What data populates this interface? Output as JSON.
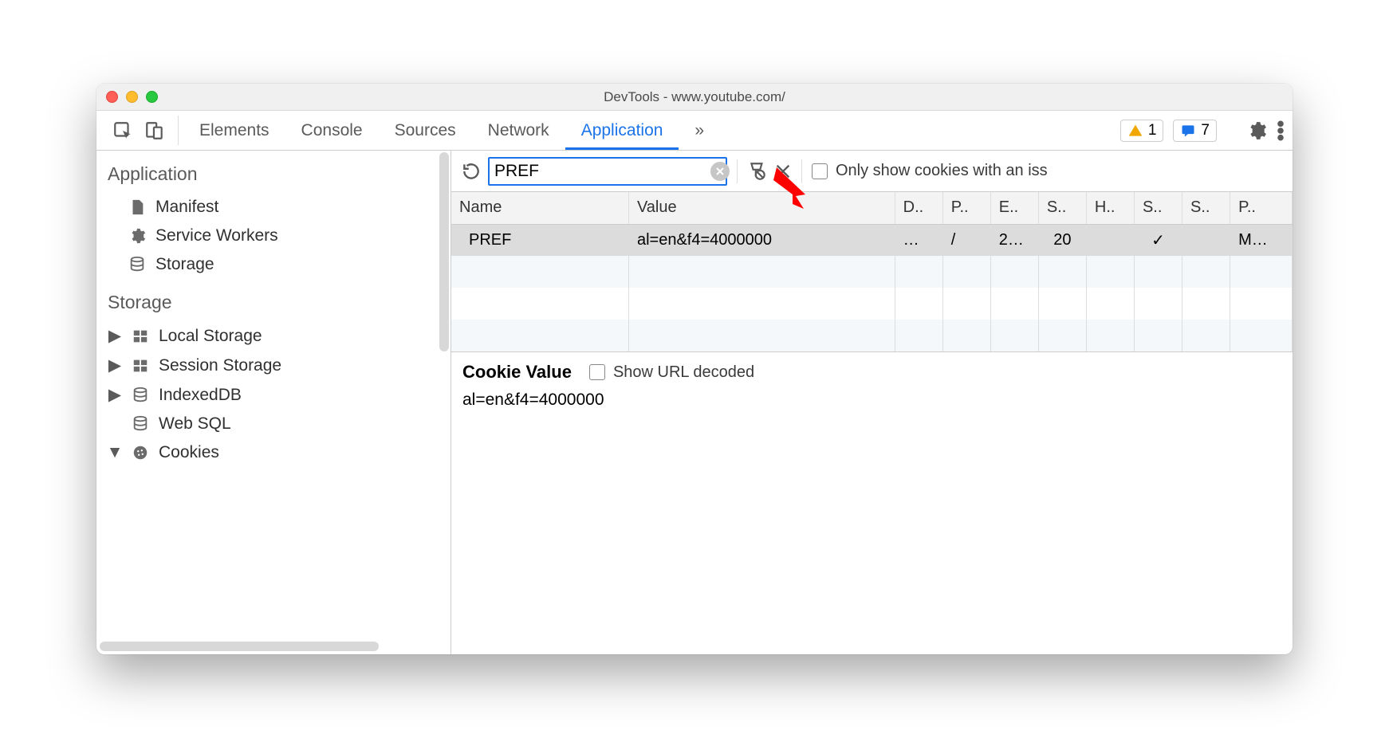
{
  "window": {
    "title": "DevTools - www.youtube.com/"
  },
  "toolbar": {
    "tabs": [
      "Elements",
      "Console",
      "Sources",
      "Network",
      "Application"
    ],
    "active_tab": "Application",
    "more": "»",
    "warnings": "1",
    "messages": "7"
  },
  "sidebar": {
    "sections": [
      {
        "title": "Application",
        "items": [
          {
            "icon": "file",
            "label": "Manifest"
          },
          {
            "icon": "gear",
            "label": "Service Workers"
          },
          {
            "icon": "db",
            "label": "Storage"
          }
        ]
      },
      {
        "title": "Storage",
        "items": [
          {
            "icon": "grid",
            "label": "Local Storage",
            "caret": "right"
          },
          {
            "icon": "grid",
            "label": "Session Storage",
            "caret": "right"
          },
          {
            "icon": "db",
            "label": "IndexedDB",
            "caret": "right"
          },
          {
            "icon": "db",
            "label": "Web SQL"
          },
          {
            "icon": "cookie",
            "label": "Cookies",
            "caret": "down"
          }
        ]
      }
    ]
  },
  "cookies": {
    "filter": "PREF",
    "issues_checkbox_label": "Only show cookies with an iss",
    "columns": [
      "Name",
      "Value",
      "D..",
      "P..",
      "E..",
      "S..",
      "H..",
      "S..",
      "S..",
      "P.."
    ],
    "rows": [
      {
        "name": "PREF",
        "value": "al=en&f4=4000000",
        "domain": "…",
        "path": "/",
        "expires": "2…",
        "size": "20",
        "httponly": "",
        "secure": "✓",
        "samesite": "",
        "priority": "M…"
      }
    ],
    "detail": {
      "heading": "Cookie Value",
      "url_decoded_label": "Show URL decoded",
      "value": "al=en&f4=4000000"
    }
  }
}
